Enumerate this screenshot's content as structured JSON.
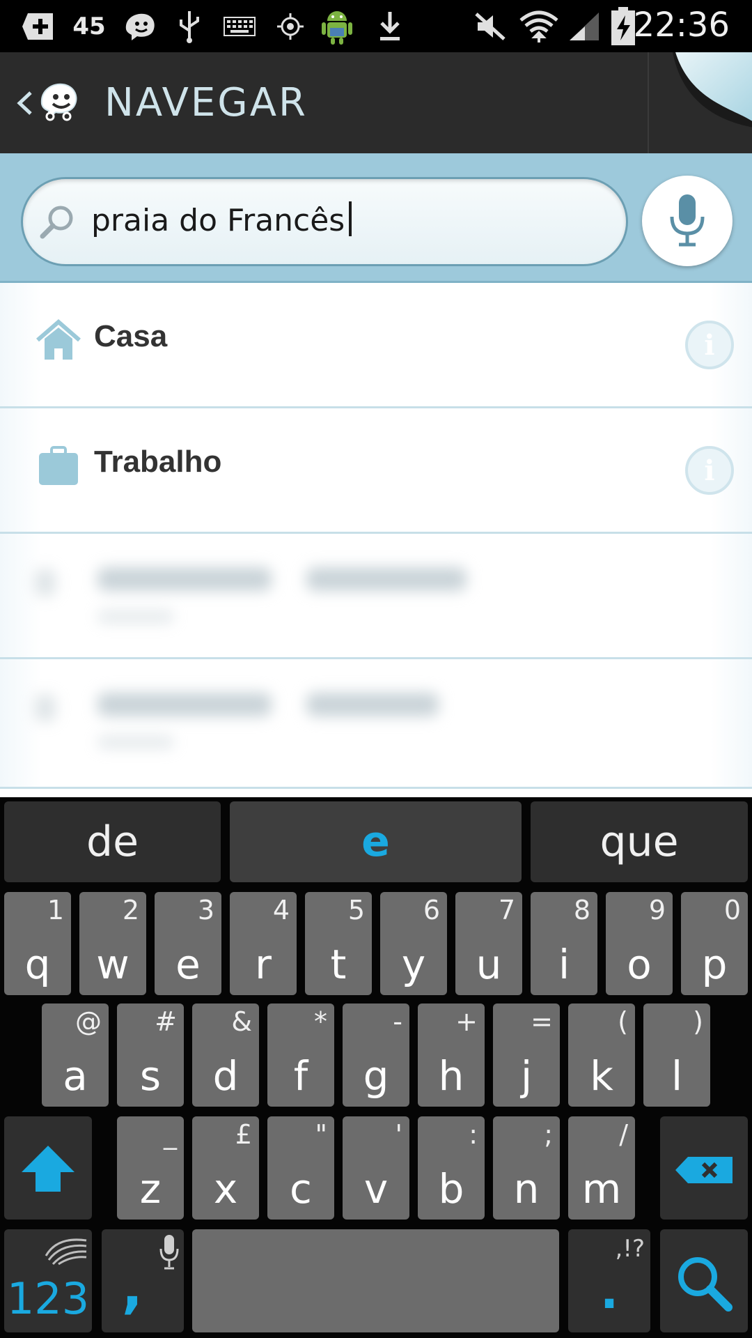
{
  "status_bar": {
    "notification_count": "45",
    "time": "22:36"
  },
  "header": {
    "title": "NAVEGAR"
  },
  "search": {
    "value": "praia do Francês"
  },
  "favorites": [
    {
      "label": "Casa",
      "icon": "home-icon"
    },
    {
      "label": "Trabalho",
      "icon": "briefcase-icon"
    }
  ],
  "keyboard": {
    "suggestions": [
      "de",
      "e",
      "que"
    ],
    "row1": [
      {
        "main": "q",
        "alt": "1"
      },
      {
        "main": "w",
        "alt": "2"
      },
      {
        "main": "e",
        "alt": "3"
      },
      {
        "main": "r",
        "alt": "4"
      },
      {
        "main": "t",
        "alt": "5"
      },
      {
        "main": "y",
        "alt": "6"
      },
      {
        "main": "u",
        "alt": "7"
      },
      {
        "main": "i",
        "alt": "8"
      },
      {
        "main": "o",
        "alt": "9"
      },
      {
        "main": "p",
        "alt": "0"
      }
    ],
    "row2": [
      {
        "main": "a",
        "alt": "@"
      },
      {
        "main": "s",
        "alt": "#"
      },
      {
        "main": "d",
        "alt": "&"
      },
      {
        "main": "f",
        "alt": "*"
      },
      {
        "main": "g",
        "alt": "-"
      },
      {
        "main": "h",
        "alt": "+"
      },
      {
        "main": "j",
        "alt": "="
      },
      {
        "main": "k",
        "alt": "("
      },
      {
        "main": "l",
        "alt": ")"
      }
    ],
    "row3": [
      {
        "main": "z",
        "alt": "_"
      },
      {
        "main": "x",
        "alt": "£"
      },
      {
        "main": "c",
        "alt": "\""
      },
      {
        "main": "v",
        "alt": "'"
      },
      {
        "main": "b",
        "alt": ":"
      },
      {
        "main": "n",
        "alt": ";"
      },
      {
        "main": "m",
        "alt": "/"
      }
    ],
    "numbers_label": "123",
    "comma_label": ",",
    "period_label": ".",
    "period_alt": ",!?"
  },
  "colors": {
    "accent": "#1aa9e0",
    "search_bar": "#9dc9db",
    "header": "#2b2b2b"
  }
}
